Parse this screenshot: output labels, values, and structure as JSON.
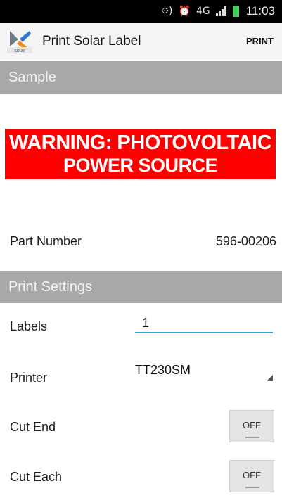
{
  "status_bar": {
    "time": "11:03",
    "network": "4G",
    "battery_color": "#3fd05a",
    "icons": [
      "nfc-icon",
      "alarm-icon",
      "network-4g-icon",
      "signal-icon",
      "battery-icon"
    ]
  },
  "action_bar": {
    "logo_text": "solar",
    "title": "Print Solar Label",
    "print_label": "PRINT"
  },
  "sample_section": {
    "header": "Sample",
    "label_line1": "WARNING: PHOTOVOLTAIC",
    "label_line2": "POWER SOURCE",
    "label_color": "#ff0000",
    "part_number_label": "Part Number",
    "part_number_value": "596-00206"
  },
  "settings_section": {
    "header": "Print Settings",
    "labels_label": "Labels",
    "labels_value": "1",
    "printer_label": "Printer",
    "printer_value": "TT230SM",
    "cut_end_label": "Cut End",
    "cut_end_state": "OFF",
    "cut_each_label": "Cut Each",
    "cut_each_state": "OFF"
  },
  "colors": {
    "section_header_bg": "#a8a8a8",
    "input_underline": "#2aa7d6"
  }
}
